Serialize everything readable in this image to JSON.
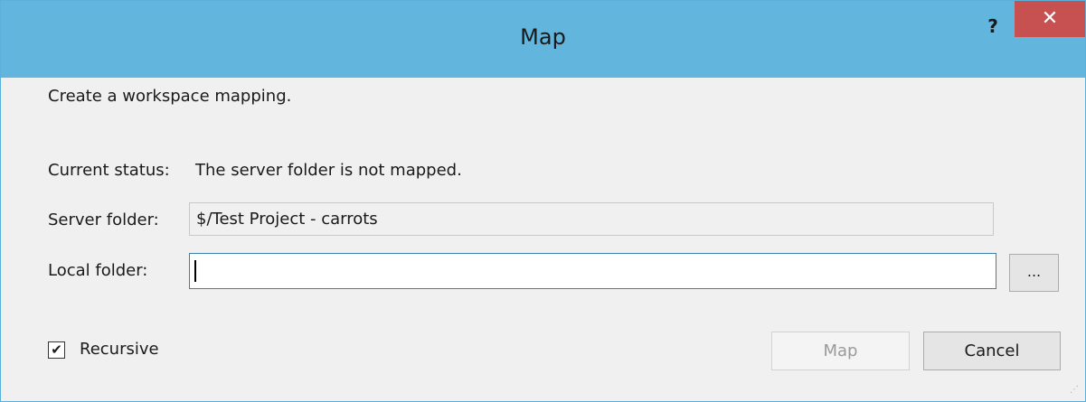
{
  "window": {
    "title": "Map",
    "help_label": "?",
    "close_label": "✕",
    "accent": "#62b5dc",
    "close_color": "#c75050"
  },
  "dialog": {
    "description": "Create a workspace mapping.",
    "status_label": "Current status:",
    "status_value": "The server folder is not mapped.",
    "server_label": "Server folder:",
    "server_value": "$/Test Project - carrots",
    "local_label": "Local folder:",
    "local_value": "",
    "browse_label": "...",
    "recursive_label": "Recursive",
    "recursive_checked": true,
    "check_glyph": "✔",
    "map_label": "Map",
    "cancel_label": "Cancel"
  }
}
